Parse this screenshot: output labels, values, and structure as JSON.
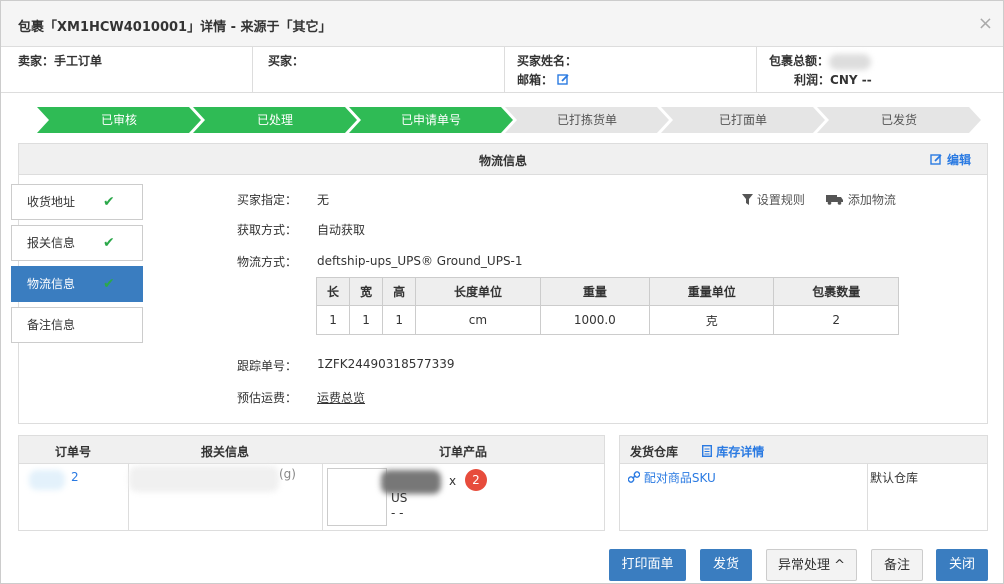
{
  "dialog": {
    "title": "包裹「XM1HCW4010001」详情 - 来源于「其它」",
    "close_label": "×"
  },
  "info": {
    "seller_label": "卖家：",
    "seller_value": "手工订单",
    "buyer_label": "买家：",
    "buyer_name_label": "买家姓名：",
    "email_label": "邮箱：",
    "total_label": "包裹总额：",
    "profit_label": "利润：",
    "profit_value": "CNY --"
  },
  "steps": [
    {
      "label": "已审核",
      "status": "done"
    },
    {
      "label": "已处理",
      "status": "done"
    },
    {
      "label": "已申请单号",
      "status": "done"
    },
    {
      "label": "已打拣货单",
      "status": "pending"
    },
    {
      "label": "已打面单",
      "status": "pending"
    },
    {
      "label": "已发货",
      "status": "pending"
    }
  ],
  "colors": {
    "step_done": "#2fbb55",
    "step_pending": "#e5e5e5",
    "primary": "#3a7dc0",
    "link": "#2a7ae2",
    "check": "#2ba84a",
    "badge": "#e74c3c"
  },
  "logistics": {
    "header": "物流信息",
    "edit_label": "编辑",
    "buyer_specified_label": "买家指定：",
    "buyer_specified_value": "无",
    "fetch_method_label": "获取方式：",
    "fetch_method_value": "自动获取",
    "method_label": "物流方式：",
    "method_value": "deftship-ups_UPS® Ground_UPS-1",
    "tracking_label": "跟踪单号：",
    "tracking_value": "1ZFK24490318577339",
    "estimate_label": "预估运费：",
    "estimate_value": "运费总览",
    "set_rule_label": "设置规则",
    "add_logistics_label": "添加物流",
    "table": {
      "headers": [
        "长",
        "宽",
        "高",
        "长度单位",
        "重量",
        "重量单位",
        "包裹数量"
      ],
      "row": [
        "1",
        "1",
        "1",
        "cm",
        "1000.0",
        "克",
        "2"
      ]
    }
  },
  "sidenav": [
    {
      "label": "收货地址",
      "check": "✔",
      "active": false
    },
    {
      "label": "报关信息",
      "check": "✔",
      "active": false
    },
    {
      "label": "物流信息",
      "check": "✔",
      "active": true
    },
    {
      "label": "备注信息",
      "check": "",
      "active": false
    }
  ],
  "orders": {
    "col_order": "订单号",
    "col_customs": "报关信息",
    "col_product": "订单产品",
    "order_fragment": "2",
    "customs_fragment": "(g)",
    "product_fragment_1": "x",
    "product_fragment_2": "US",
    "product_fragment_3": "- -",
    "badge": "2"
  },
  "warehouse": {
    "col_label": "发货仓库",
    "detail_label": "库存详情",
    "match_sku_label": "配对商品SKU",
    "default_wh": "默认仓库"
  },
  "buttons": {
    "print": "打印面单",
    "ship": "发货",
    "exception": "异常处理",
    "note": "备注",
    "close": "关闭"
  }
}
